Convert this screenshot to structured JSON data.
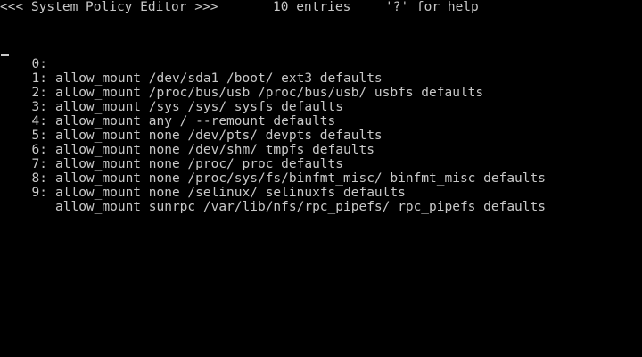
{
  "header": {
    "title": "<<< System Policy Editor >>>",
    "entry_count": "10 entries",
    "help_hint": "'?' for help"
  },
  "colors": {
    "background": "#000000",
    "foreground": "#c8c8c8"
  },
  "entries": [
    {
      "index": "0:",
      "text": "allow_mount /dev/sda1 /boot/ ext3 defaults"
    },
    {
      "index": "1:",
      "text": "allow_mount /proc/bus/usb /proc/bus/usb/ usbfs defaults"
    },
    {
      "index": "2:",
      "text": "allow_mount /sys /sys/ sysfs defaults"
    },
    {
      "index": "3:",
      "text": "allow_mount any / --remount defaults"
    },
    {
      "index": "4:",
      "text": "allow_mount none /dev/pts/ devpts defaults"
    },
    {
      "index": "5:",
      "text": "allow_mount none /dev/shm/ tmpfs defaults"
    },
    {
      "index": "6:",
      "text": "allow_mount none /proc/ proc defaults"
    },
    {
      "index": "7:",
      "text": "allow_mount none /proc/sys/fs/binfmt_misc/ binfmt_misc defaults"
    },
    {
      "index": "8:",
      "text": "allow_mount none /selinux/ selinuxfs defaults"
    },
    {
      "index": "9:",
      "text": "allow_mount sunrpc /var/lib/nfs/rpc_pipefs/ rpc_pipefs defaults"
    }
  ]
}
